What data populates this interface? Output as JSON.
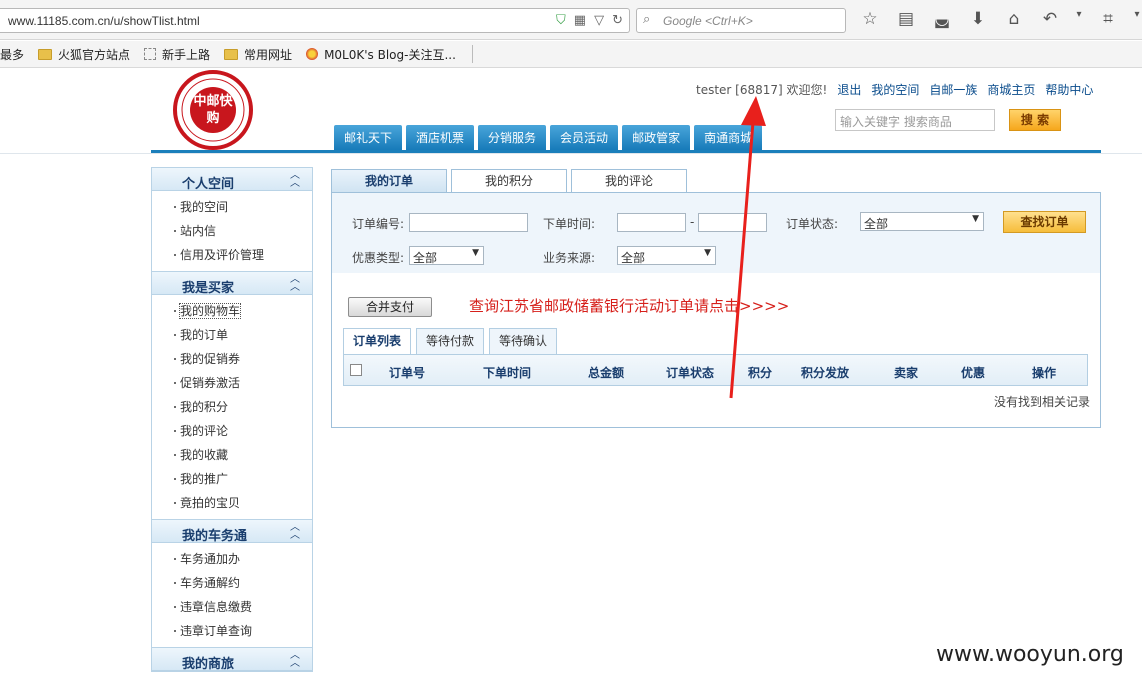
{
  "browser": {
    "url": "www.11185.com.cn/u/showTlist.html",
    "search_placeholder": "Google <Ctrl+K>",
    "bookmarks": [
      "最多",
      "火狐官方站点",
      "新手上路",
      "常用网址",
      "M0L0K's Blog-关注互..."
    ]
  },
  "header": {
    "logo_text": "中邮快购",
    "username": "tester [68817]",
    "welcome": "欢迎您!",
    "links": [
      "退出",
      "我的空间",
      "自邮一族",
      "商城主页",
      "帮助中心"
    ],
    "search_placeholder": "输入关键字 搜索商品",
    "search_button": "搜 索",
    "nav": [
      "邮礼天下",
      "酒店机票",
      "分销服务",
      "会员活动",
      "邮政管家",
      "南通商城"
    ]
  },
  "sidebar": {
    "groups": [
      {
        "title": "个人空间",
        "items": [
          "我的空间",
          "站内信",
          "信用及评价管理"
        ]
      },
      {
        "title": "我是买家",
        "items": [
          "我的购物车",
          "我的订单",
          "我的促销券",
          "促销券激活",
          "我的积分",
          "我的评论",
          "我的收藏",
          "我的推广",
          "竟拍的宝贝"
        ]
      },
      {
        "title": "我的车务通",
        "items": [
          "车务通加办",
          "车务通解约",
          "违章信息缴费",
          "违章订单查询"
        ]
      },
      {
        "title": "我的商旅",
        "items": []
      }
    ]
  },
  "main": {
    "tabs": [
      "我的订单",
      "我的积分",
      "我的评论"
    ],
    "filter": {
      "order_no_label": "订单编号:",
      "time_label": "下单时间:",
      "time_sep": "-",
      "status_label": "订单状态:",
      "status_value": "全部",
      "discount_label": "优惠类型:",
      "discount_value": "全部",
      "source_label": "业务来源:",
      "source_value": "全部",
      "find_button": "查找订单"
    },
    "merge_button": "合并支付",
    "promo_link": "查询江苏省邮政储蓄银行活动订单请点击>>>>",
    "subtabs": [
      "订单列表",
      "等待付款",
      "等待确认"
    ],
    "columns": [
      "订单号",
      "下单时间",
      "总金额",
      "订单状态",
      "积分",
      "积分发放",
      "卖家",
      "优惠",
      "操作"
    ],
    "empty_text": "没有找到相关记录"
  },
  "watermark": "www.wooyun.org",
  "colors": {
    "nav_blue": "#1b7fbb",
    "logo_red": "#c8161d",
    "promo_red": "#d6201b",
    "arrow_red": "#e8201c"
  }
}
